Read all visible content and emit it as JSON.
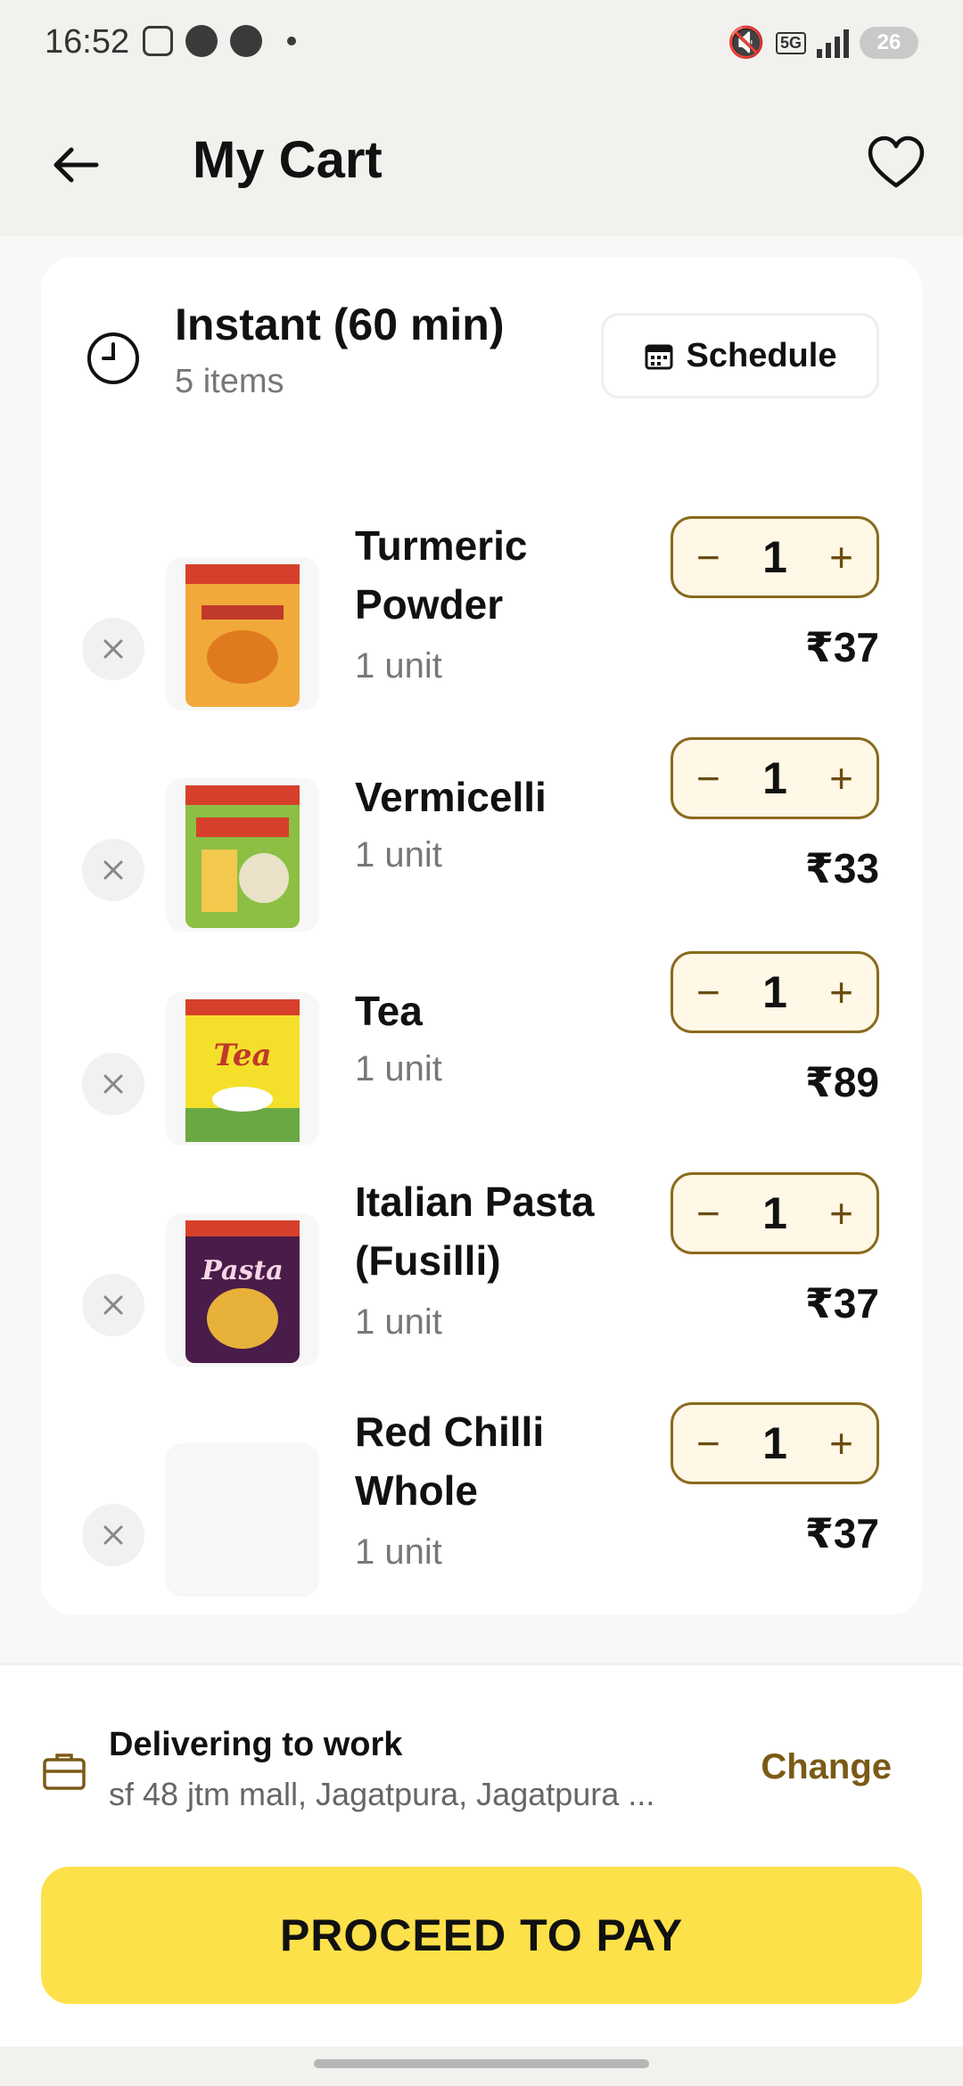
{
  "status_bar": {
    "time": "16:52",
    "network": "5G",
    "battery": "26"
  },
  "header": {
    "title": "My Cart",
    "back_icon": "arrow-left-icon",
    "favorite_icon": "heart-icon"
  },
  "delivery_slot": {
    "title": "Instant (60 min)",
    "item_count": "5 items",
    "schedule_label": "Schedule"
  },
  "cart_items": [
    {
      "name": "Turmeric Powder",
      "unit": "1 unit",
      "qty": "1",
      "price": "₹37",
      "thumb_color": "#f1a93a"
    },
    {
      "name": "Vermicelli",
      "unit": "1 unit",
      "qty": "1",
      "price": "₹33",
      "thumb_color": "#8cbf43"
    },
    {
      "name": "Tea",
      "unit": "1 unit",
      "qty": "1",
      "price": "₹89",
      "thumb_color": "#f4e02a"
    },
    {
      "name": "Italian Pasta (Fusilli)",
      "unit": "1 unit",
      "qty": "1",
      "price": "₹37",
      "thumb_color": "#4a1c4a"
    },
    {
      "name": "Red Chilli Whole",
      "unit": "1 unit",
      "qty": "1",
      "price": "₹37",
      "thumb_color": ""
    }
  ],
  "qty_controls": {
    "minus": "−",
    "plus": "+"
  },
  "delivery_address": {
    "title": "Delivering to work",
    "address": "sf 48 jtm mall, Jagatpura, Jagatpura ...",
    "change_label": "Change"
  },
  "checkout": {
    "pay_label": "PROCEED TO PAY"
  },
  "colors": {
    "accent": "#fde14a",
    "qty_border": "#8a6a1f",
    "change_text": "#7a5a16"
  }
}
